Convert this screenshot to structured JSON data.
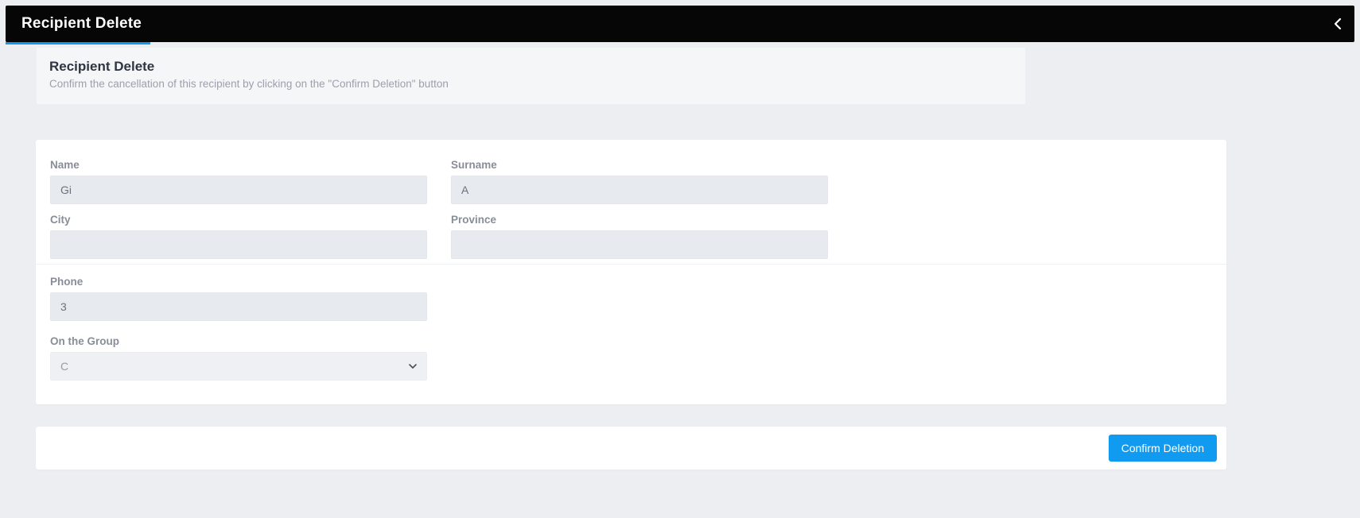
{
  "topbar": {
    "title": "Recipient Delete"
  },
  "subheader": {
    "title": "Recipient Delete",
    "desc": "Confirm the cancellation of this recipient by clicking on the \"Confirm Deletion\" button"
  },
  "form": {
    "name_label": "Name",
    "name_value": "Gi",
    "surname_label": "Surname",
    "surname_value": "A",
    "city_label": "City",
    "city_value": "",
    "province_label": "Province",
    "province_value": "",
    "phone_label": "Phone",
    "phone_value": "3",
    "group_label": "On the Group",
    "group_value": "C"
  },
  "actions": {
    "confirm_label": "Confirm Deletion"
  }
}
